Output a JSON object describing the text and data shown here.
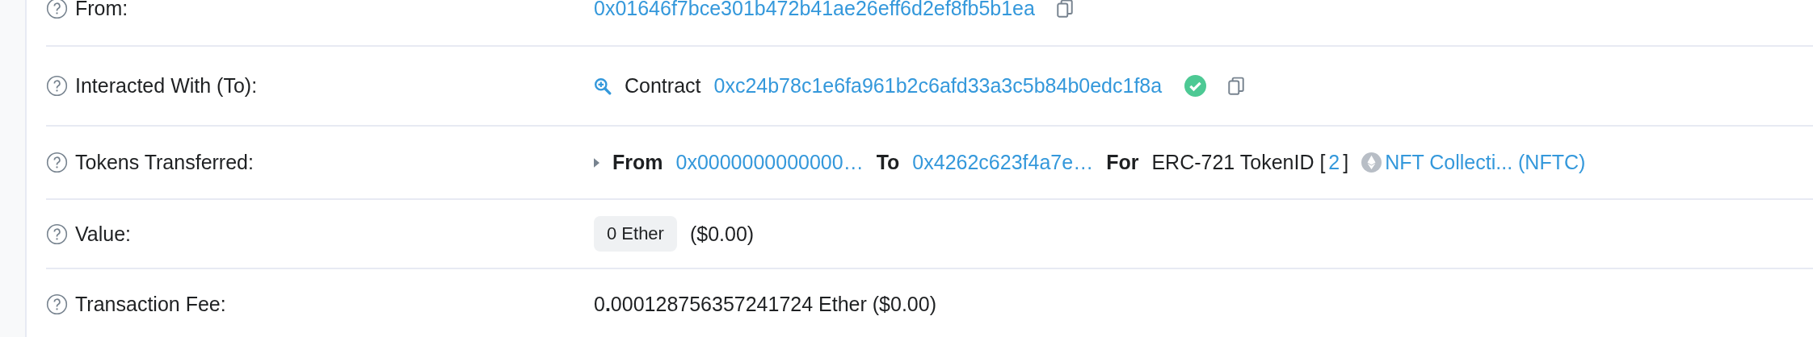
{
  "rows": [
    {
      "kind": "address",
      "label": "From:",
      "address": "0x01646f7bce301b472b41ae26eff6d2ef8fb5b1ea"
    },
    {
      "kind": "contract",
      "label": "Interacted With (To):",
      "prefix": "Contract",
      "address": "0xc24b78c1e6fa961b2c6afd33a3c5b84b0edc1f8a",
      "verified": true
    },
    {
      "kind": "tokens",
      "label": "Tokens Transferred:",
      "from_label": "From",
      "from": "0x0000000000000…",
      "to_label": "To",
      "to": "0x4262c623f4a7e…",
      "for_label": "For",
      "standard": "ERC-721 TokenID [",
      "token_id": "2",
      "close": "]",
      "token": "NFT Collecti... (NFTC)"
    },
    {
      "kind": "value",
      "label": "Value:",
      "amount": "0 Ether",
      "usd": "($0.00)"
    },
    {
      "kind": "fee",
      "label": "Transaction Fee:",
      "text": "0**.**000128756357241724 Ether ($0.00)"
    }
  ]
}
